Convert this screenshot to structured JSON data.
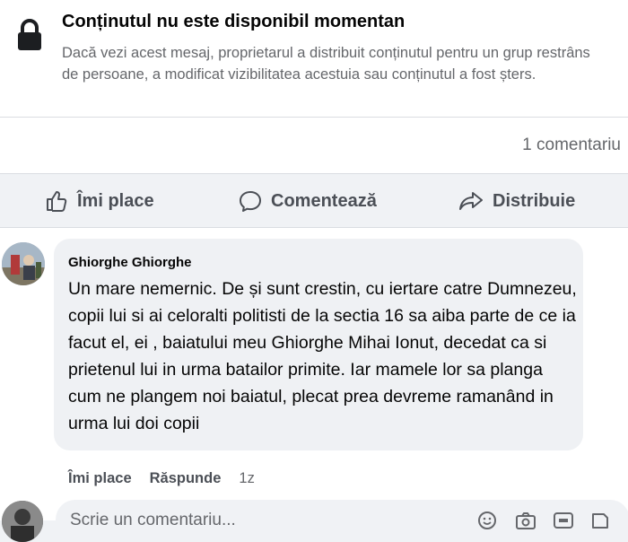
{
  "notice": {
    "title": "Conținutul nu este disponibil momentan",
    "body": "Dacă vezi acest mesaj, proprietarul a distribuit conținutul pentru un grup restrâns de persoane, a modificat vizibilitatea acestuia sau conținutul a fost șters.",
    "icon": "lock-icon"
  },
  "stats": {
    "comments": "1 comentariu"
  },
  "actions": {
    "like": "Îmi place",
    "comment": "Comentează",
    "share": "Distribuie"
  },
  "comment": {
    "author": "Ghiorghe Ghiorghe",
    "text": "Un mare nemernic. De și sunt crestin, cu iertare catre Dumnezeu, copii lui si ai celoralti politisti de la sectia 16 sa aiba parte de ce ia facut el, ei , baiatului meu Ghiorghe Mihai Ionut, decedat ca si prietenul lui in urma batailor primite. Iar mamele lor sa planga cum ne plangem noi baiatul, plecat prea devreme ramanând in urma lui doi copii",
    "like_label": "Îmi place",
    "reply_label": "Răspunde",
    "time": "1z"
  },
  "composer": {
    "placeholder": "Scrie un comentariu..."
  },
  "colors": {
    "background": "#f0f2f5",
    "bubble": "#eff1f4",
    "secondary_text": "#65676b"
  }
}
